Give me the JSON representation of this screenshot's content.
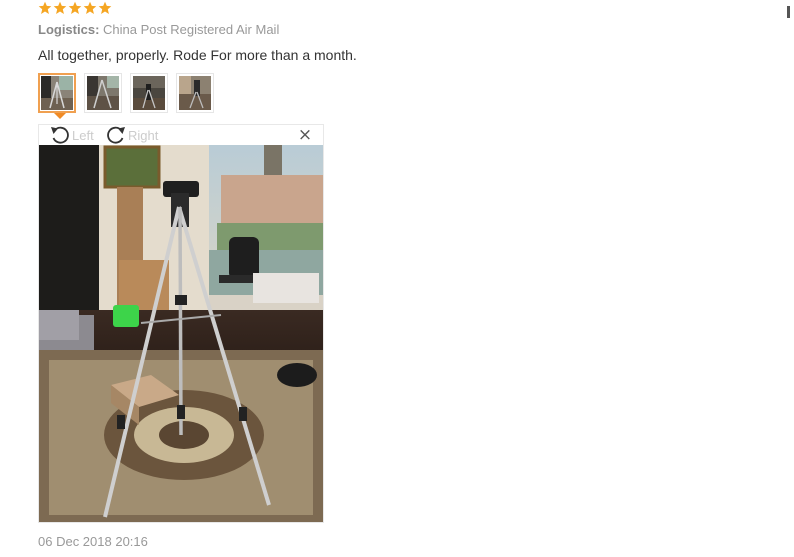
{
  "review": {
    "rating": 5,
    "logistics_label": "Logistics:",
    "logistics_value": "China Post Registered Air Mail",
    "text": "All together, properly. Rode For more than a month.",
    "date": "06 Dec 2018 20:16"
  },
  "thumbnails": [
    {
      "name": "photo-1",
      "selected": true
    },
    {
      "name": "photo-2",
      "selected": false
    },
    {
      "name": "photo-3",
      "selected": false
    },
    {
      "name": "photo-4",
      "selected": false
    }
  ],
  "viewer": {
    "rotate_left_label": "Left",
    "rotate_right_label": "Right",
    "close_label": "×"
  },
  "icons": {
    "star": "star-icon",
    "rotate_left": "rotate-left-icon",
    "rotate_right": "rotate-right-icon",
    "close": "close-icon"
  },
  "colors": {
    "star": "#f5a623",
    "selected_border": "#f0a050",
    "muted_text": "#999999"
  }
}
